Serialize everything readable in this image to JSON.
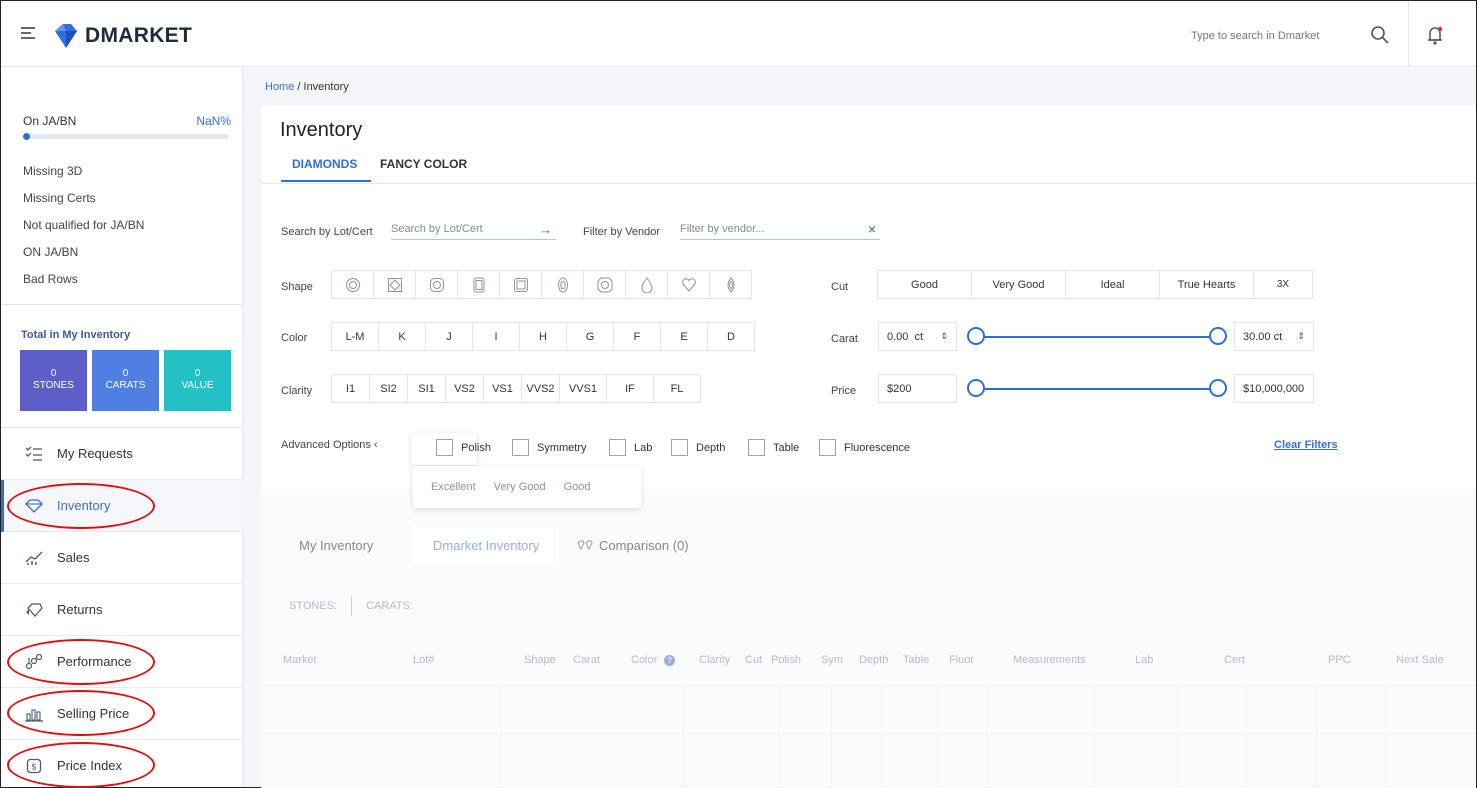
{
  "header": {
    "brand": "DMARKET",
    "search_placeholder": "Type to search in Dmarket",
    "icons": [
      "hamburger-menu-icon",
      "search-icon",
      "bell-icon"
    ]
  },
  "sidebar": {
    "on_label": "On JA/BN",
    "on_percent": "NaN%",
    "progress_fraction": 0,
    "status_items": [
      "Missing 3D",
      "Missing Certs",
      "Not qualified for JA/BN",
      "ON JA/BN",
      "Bad Rows"
    ],
    "total_label": "Total in My Inventory",
    "stats": [
      {
        "value": "0",
        "label": "STONES",
        "color": "#5b5fc7"
      },
      {
        "value": "0",
        "label": "CARATS",
        "color": "#4f7fe0"
      },
      {
        "value": "0",
        "label": "VALUE",
        "color": "#23c0c6"
      }
    ],
    "nav": [
      {
        "label": "My Requests",
        "icon": "list-check-icon"
      },
      {
        "label": "Inventory",
        "icon": "diamond-icon",
        "active": true
      },
      {
        "label": "Sales",
        "icon": "sales-chart-icon"
      },
      {
        "label": "Returns",
        "icon": "returns-icon"
      },
      {
        "label": "Performance",
        "icon": "performance-icon"
      },
      {
        "label": "Selling Price",
        "icon": "bar-chart-icon"
      },
      {
        "label": "Price Index",
        "icon": "price-index-icon"
      }
    ]
  },
  "breadcrumb": {
    "home": "Home",
    "current": " / Inventory"
  },
  "page": {
    "title": "Inventory",
    "tabs": [
      "DIAMONDS",
      "FANCY COLOR"
    ],
    "search_label": "Search by Lot/Cert",
    "search_placeholder": "Search by Lot/Cert",
    "vendor_label": "Filter by Vendor",
    "vendor_placeholder": "Filter by vendor...",
    "shape_label": "Shape",
    "color_label": "Color",
    "clarity_label": "Clarity",
    "cut_label": "Cut",
    "carat_label": "Carat",
    "price_label": "Price",
    "colors": [
      "L-M",
      "K",
      "J",
      "I",
      "H",
      "G",
      "F",
      "E",
      "D"
    ],
    "clarities": [
      "I1",
      "SI2",
      "SI1",
      "VS2",
      "VS1",
      "VVS2",
      "VVS1",
      "IF",
      "FL"
    ],
    "cuts": [
      "Good",
      "Very Good",
      "Ideal",
      "True Hearts",
      "3X"
    ],
    "shapes": [
      "round-shape-icon",
      "princess-shape-icon",
      "cushion-shape-icon",
      "emerald-shape-icon",
      "asscher-shape-icon",
      "oval-shape-icon",
      "radiant-shape-icon",
      "pear-shape-icon",
      "heart-shape-icon",
      "marquise-shape-icon"
    ],
    "carat_min": "0.00  ct",
    "carat_max": "30.00 ct",
    "price_min": "$200",
    "price_max": "$10,000,000",
    "advanced_label": "Advanced Options ‹",
    "advanced_options": [
      "Polish",
      "Symmetry",
      "Lab",
      "Depth",
      "Table",
      "Fluorescence"
    ],
    "polish_values": [
      "Excellent",
      "Very Good",
      "Good"
    ],
    "clear_filters": "Clear Filters",
    "lower_tabs": [
      "My Inventory",
      "Dmarket Inventory",
      "Comparison (0)"
    ],
    "summary": [
      "STONES:",
      "CARATS:"
    ],
    "columns": [
      "Market",
      "Lot#",
      "Shape",
      "Carat",
      "Color",
      "Clarity",
      "Cut",
      "Polish",
      "Sym",
      "Depth",
      "Table",
      "Fluor",
      "Measurements",
      "Lab",
      "Cert",
      "PPC",
      "Next Sale"
    ]
  }
}
